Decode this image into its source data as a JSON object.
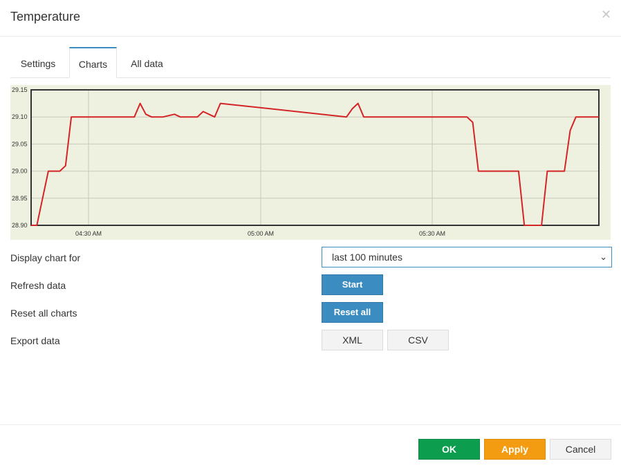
{
  "dialog": {
    "title": "Temperature",
    "close_icon": "close-icon"
  },
  "tabs": [
    {
      "label": "Settings",
      "active": false
    },
    {
      "label": "Charts",
      "active": true
    },
    {
      "label": "All data",
      "active": false
    }
  ],
  "chart_data": {
    "type": "line",
    "x_tick_labels": [
      "04:30 AM",
      "05:00 AM",
      "05:30 AM"
    ],
    "y_tick_labels": [
      "29.15",
      "29.10",
      "29.05",
      "29.00",
      "28.95",
      "28.90"
    ],
    "ylim": [
      28.9,
      29.15
    ],
    "grid": true,
    "colors": {
      "line": "#d42426",
      "background": "#eef0e0",
      "grid": "#c9c9bb",
      "frame": "#333333"
    },
    "series": [
      {
        "x": [
          0,
          1,
          3,
          5,
          6,
          7,
          18,
          19,
          20,
          21,
          23,
          25,
          26,
          29,
          30,
          31,
          32,
          33,
          55,
          56,
          57,
          58,
          76,
          77,
          78,
          85,
          86,
          89,
          90,
          93,
          94,
          95,
          99
        ],
        "values": [
          28.9,
          28.9,
          29.0,
          29.0,
          29.01,
          29.1,
          29.1,
          29.125,
          29.105,
          29.1,
          29.1,
          29.105,
          29.1,
          29.1,
          29.11,
          29.105,
          29.1,
          29.125,
          29.1,
          29.115,
          29.125,
          29.1,
          29.1,
          29.09,
          29.0,
          29.0,
          28.9,
          28.9,
          29.0,
          29.0,
          29.075,
          29.1,
          29.1
        ]
      }
    ]
  },
  "form": {
    "display_chart_label": "Display chart for",
    "display_chart_value": "last 100 minutes",
    "refresh_label": "Refresh data",
    "start_button": "Start",
    "reset_label": "Reset all charts",
    "reset_button": "Reset all",
    "export_label": "Export data",
    "xml_button": "XML",
    "csv_button": "CSV"
  },
  "footer": {
    "ok_button": "OK",
    "apply_button": "Apply",
    "cancel_button": "Cancel"
  }
}
